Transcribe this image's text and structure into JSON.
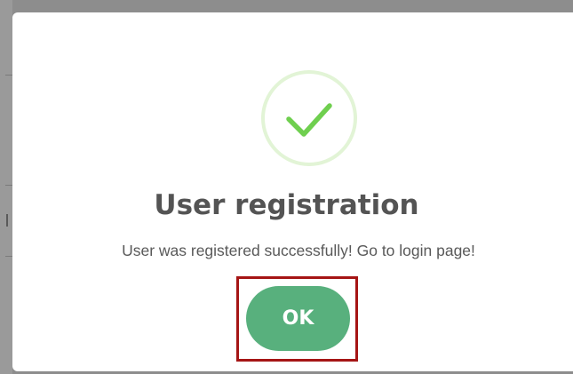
{
  "dialog": {
    "icon": "checkmark-icon",
    "title": "User registration",
    "message": "User was registered successfully! Go to login page!",
    "ok_label": "OK"
  },
  "colors": {
    "success_ring": "#e2f4d6",
    "checkmark": "#6fcf4f",
    "button": "#58b07d",
    "highlight": "#a51515"
  }
}
